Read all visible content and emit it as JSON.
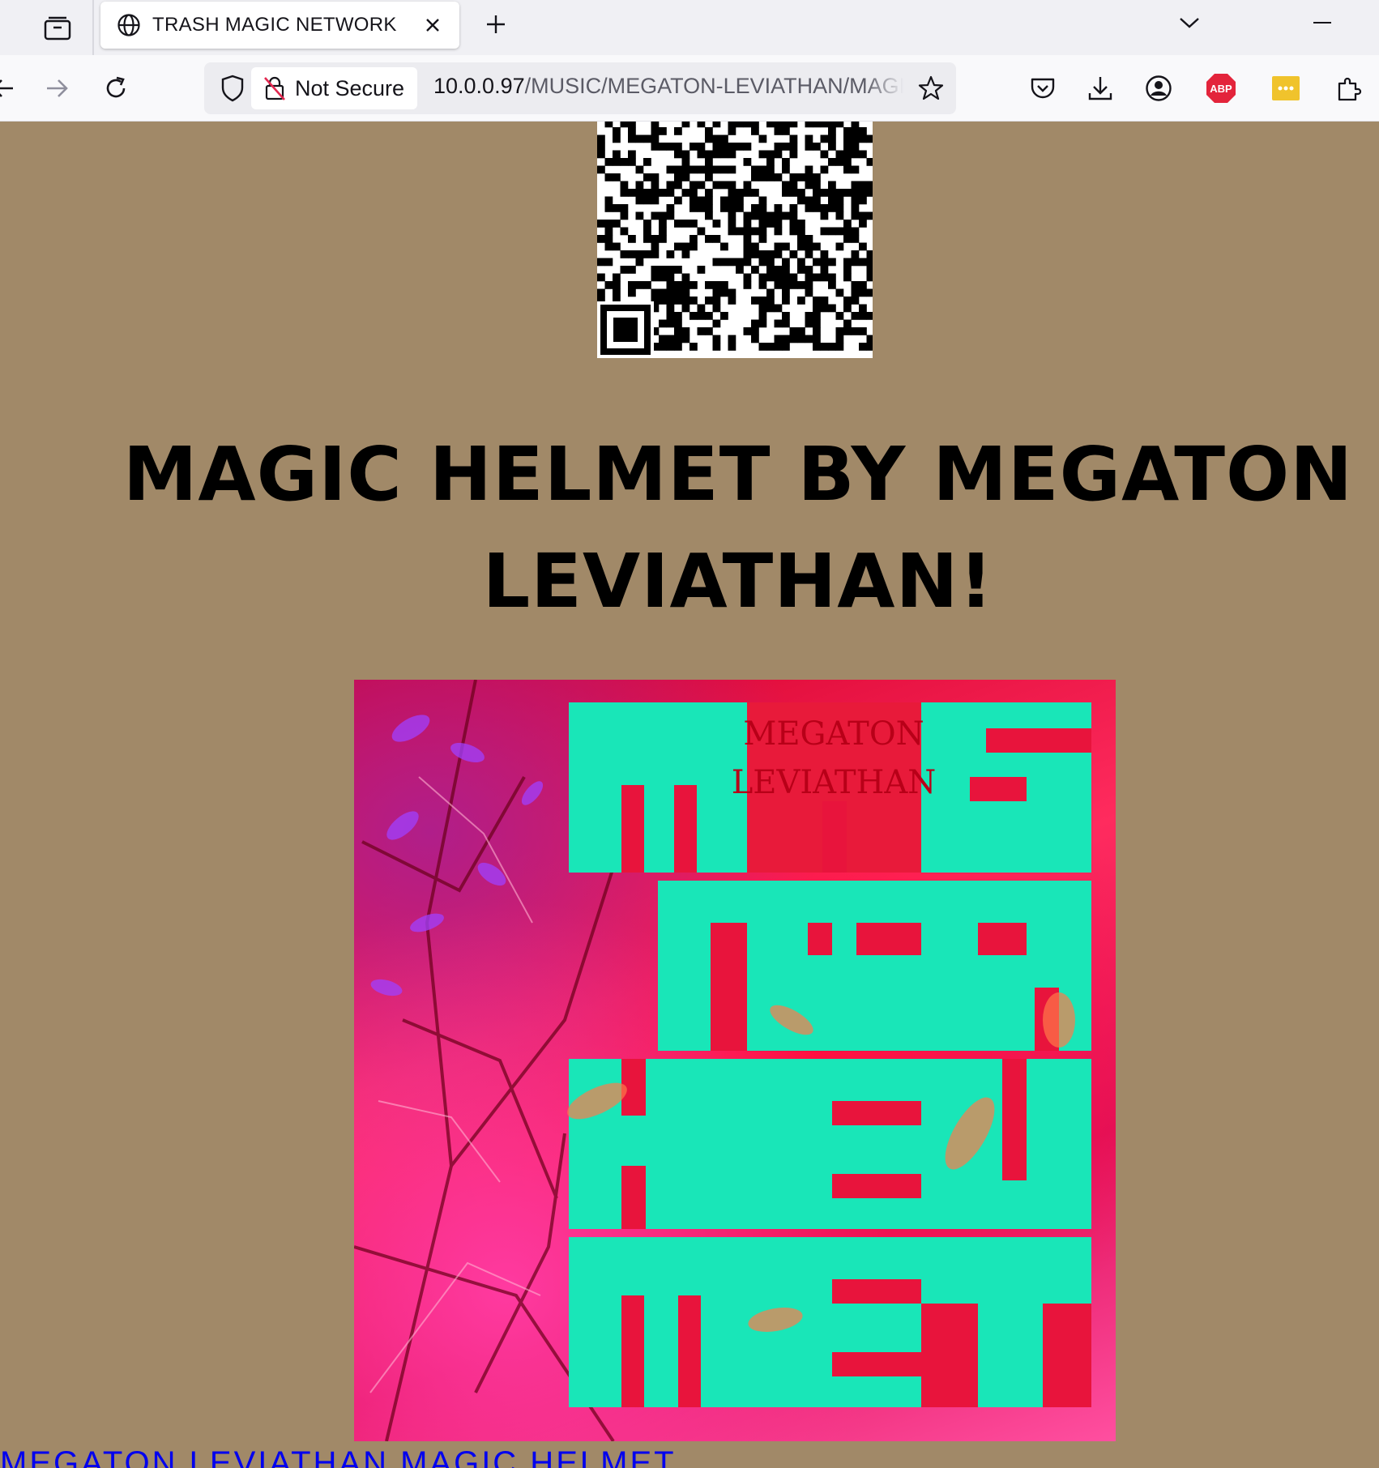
{
  "browser": {
    "tab": {
      "title": "TRASH MAGIC NETWORK"
    },
    "urlbar": {
      "security_label": "Not Secure",
      "url_host": "10.0.0.97",
      "url_path": "/MUSIC/MEGATON-LEVIATHAN/MAGIC"
    },
    "toolbar": {
      "adblock_label": "ABP",
      "icons": [
        "pocket-icon",
        "download-icon",
        "account-icon",
        "adblock-icon",
        "password-manager-icon",
        "extensions-icon"
      ]
    },
    "colors": {
      "adblock_red": "#e3243b",
      "password_yellow": "#f0c32c"
    }
  },
  "page": {
    "background_color": "#a18968",
    "headline": "MAGIC HELMET BY MEGATON LEVIATHAN!",
    "album_cover": {
      "letters": [
        "MAG",
        "IC",
        "HEL",
        "MET"
      ],
      "inset_text": [
        "MEGATON",
        "LEVIATHAN"
      ],
      "colors": {
        "red": "#ff1744",
        "cyan": "#19e6b8"
      }
    },
    "bottom_link_text": "MEGATON LEVIATHAN MAGIC HELMET"
  }
}
